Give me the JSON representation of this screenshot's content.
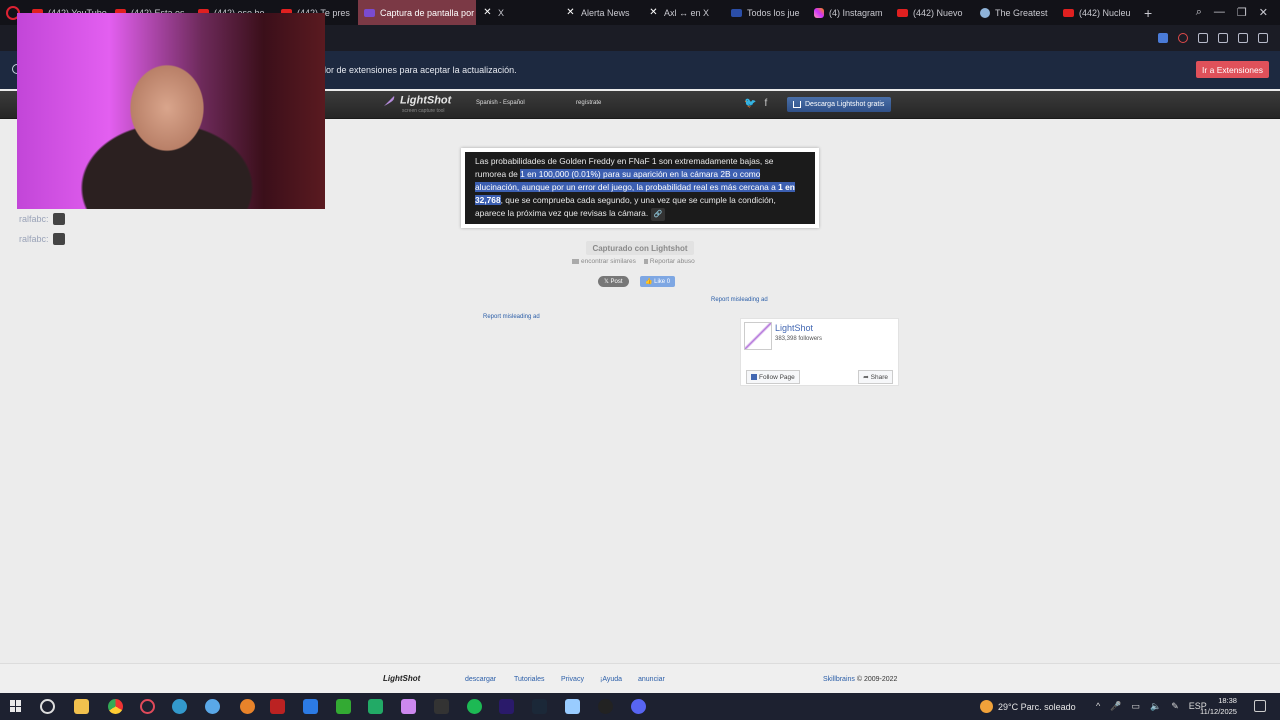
{
  "browser": {
    "tabs": [
      {
        "label": "(442) YouTube",
        "fav": "yt"
      },
      {
        "label": "(442) Esta es",
        "fav": "yt"
      },
      {
        "label": "(442) ese ho",
        "fav": "yt"
      },
      {
        "label": "(442) Te pres",
        "fav": "yt"
      },
      {
        "label": "Captura de pantalla por",
        "fav": "ls",
        "active": true
      },
      {
        "label": "X",
        "fav": "x"
      },
      {
        "label": "Alerta News",
        "fav": "x"
      },
      {
        "label": "Axl ↔ en X",
        "fav": "x"
      },
      {
        "label": "Todos los jue",
        "fav": "vx"
      },
      {
        "label": "(4) Instagram",
        "fav": "ig"
      },
      {
        "label": "(442) Nuevo",
        "fav": "yt"
      },
      {
        "label": "The Greatest",
        "fav": "st"
      },
      {
        "label": "(442) Nucleu",
        "fav": "yt"
      }
    ]
  },
  "notice": {
    "text": "ador de extensiones para aceptar la actualización.",
    "button": "Ir a Extensiones"
  },
  "header": {
    "logo": "LightShot",
    "tagline": "screen capture tool",
    "language": "Spanish - Español",
    "signin": "regístrate",
    "download": "Descarga Lightshot gratis"
  },
  "chat": [
    {
      "user": "ralfabc:"
    },
    {
      "user": "ralfabc:"
    }
  ],
  "screenshot": {
    "line1": "Las probabilidades de Golden Freddy en FNaF 1 son extremadamente bajas, se",
    "line2a": "rumorea de ",
    "line2b": "1 en 100,000 (0.01%) para su aparición en la cámara 2B o como",
    "line3": "alucinación, aunque por un error del juego, la probabilidad real es más cercana a ",
    "line3b": "1 en",
    "line4a": "32,768",
    "line4b": ", que se comprueba cada segundo, y una vez que se cumple la condición,",
    "line5": "aparece la próxima vez que revisas la cámara.",
    "chip": "🔗"
  },
  "captured": "Capturado con Lightshot",
  "links": {
    "similar": "encontrar similares",
    "report": "Reportar abuso"
  },
  "social": {
    "post": "𝕏 Post",
    "like": "👍 Like 0"
  },
  "ads": {
    "report1": "Report misleading ad",
    "report2": "Report misleading ad"
  },
  "fb": {
    "name": "LightShot",
    "followers": "383,398 followers",
    "follow": "Follow Page",
    "share": "Share"
  },
  "footer": {
    "logo": "LightShot",
    "links": [
      "descargar",
      "Tutoriales",
      "Privacy",
      "¡Ayuda",
      "anunciar"
    ],
    "copy_brand": "Skillbrains",
    "copy_text": " © 2009-2022"
  },
  "taskbar": {
    "weather": "29°C  Parc. soleado",
    "lang": "ESP",
    "time": "18:38",
    "date": "11/12/2025"
  }
}
